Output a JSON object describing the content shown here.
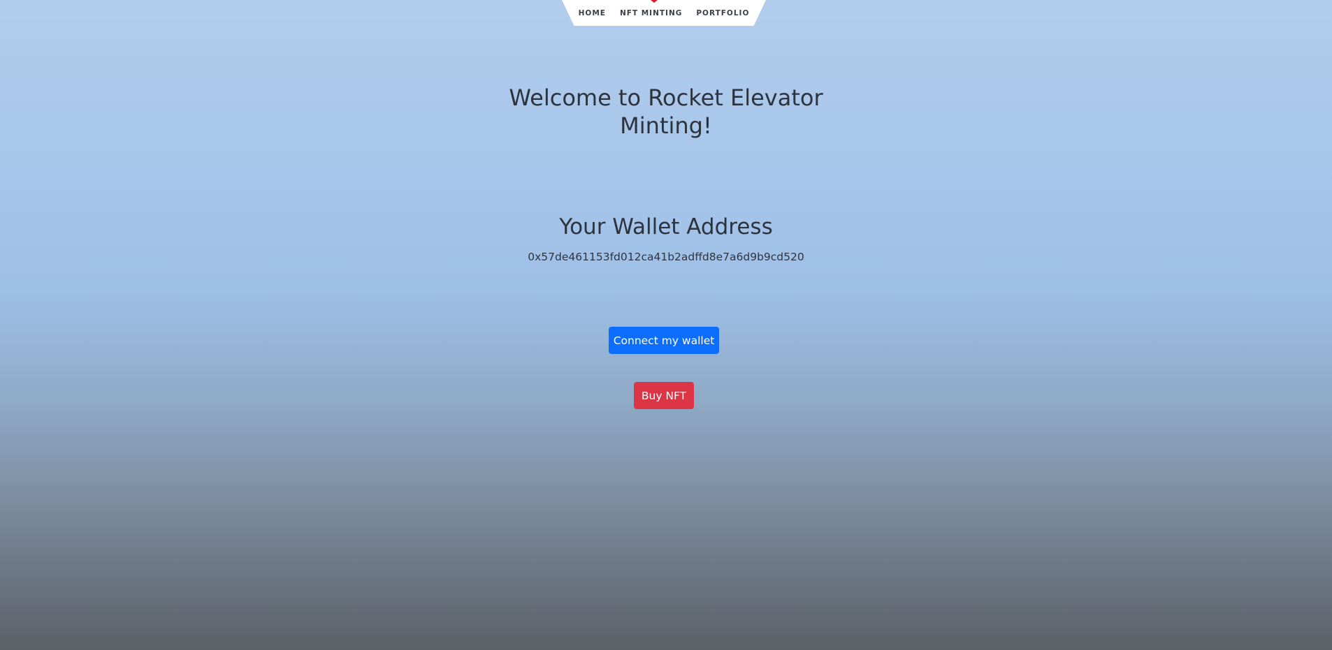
{
  "nav": {
    "items": [
      {
        "label": "HOME"
      },
      {
        "label": "NFT MINTING"
      },
      {
        "label": "PORTFOLIO"
      }
    ],
    "accent_color": "#d8182e"
  },
  "main": {
    "title_line1": "Welcome to Rocket Elevator",
    "title_line2": "Minting!",
    "wallet_heading": "Your Wallet Address",
    "wallet_address": "0x57de461153fd012ca41b2adffd8e7a6d9b9cd520"
  },
  "buttons": {
    "connect_label": "Connect my wallet",
    "connect_color": "#0d6efd",
    "buy_label": "Buy NFT",
    "buy_color": "#dc3545"
  }
}
